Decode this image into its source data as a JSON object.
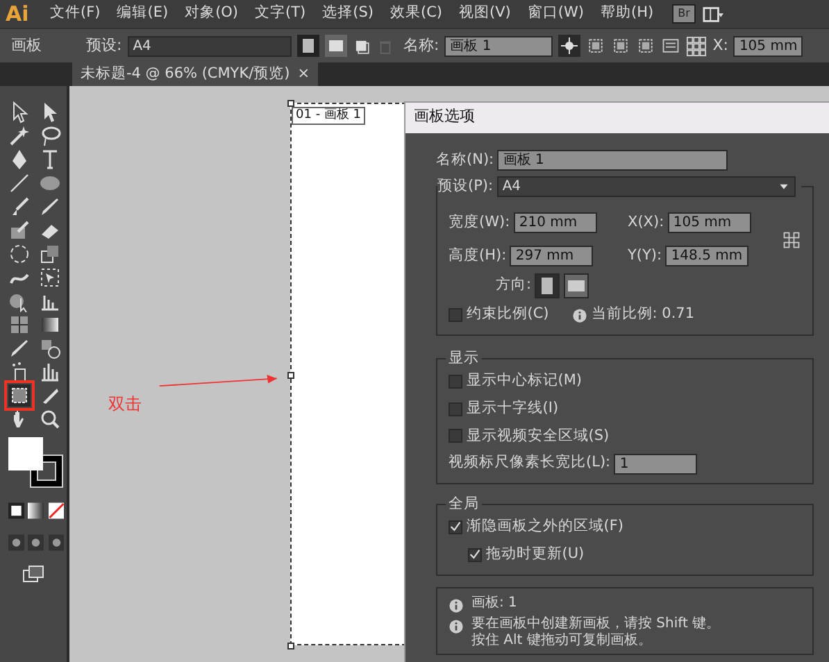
{
  "app_logo": "Ai",
  "menu": [
    "文件(F)",
    "编辑(E)",
    "对象(O)",
    "文字(T)",
    "选择(S)",
    "效果(C)",
    "视图(V)",
    "窗口(W)",
    "帮助(H)"
  ],
  "bridge_label": "Br",
  "control_bar": {
    "label": "画板",
    "preset_label": "预设:",
    "preset_value": "A4",
    "name_label": "名称:",
    "name_value": "画板 1",
    "x_label": "X:",
    "x_value": "105 mm"
  },
  "document_tab": {
    "title": "未标题-4 @ 66% (CMYK/预览)",
    "close": "×"
  },
  "artboard_label": "01 - 画板 1",
  "annotation": "双击",
  "dialog": {
    "title": "画板选项",
    "name_label": "名称(N):",
    "name_value": "画板 1",
    "preset_label": "预设(P):",
    "preset_value": "A4",
    "width_label": "宽度(W):",
    "width_value": "210 mm",
    "height_label": "高度(H):",
    "height_value": "297 mm",
    "x_label": "X(X):",
    "x_value": "105 mm",
    "y_label": "Y(Y):",
    "y_value": "148.5 mm",
    "orientation_label": "方向:",
    "orientation": [
      {
        "selected": true
      },
      {
        "selected": false
      }
    ],
    "constrain": {
      "label": "约束比例(C)",
      "checked": false
    },
    "current_ratio": "当前比例: 0.71",
    "display": {
      "title": "显示",
      "options": [
        {
          "label": "显示中心标记(M)",
          "checked": false
        },
        {
          "label": "显示十字线(I)",
          "checked": false
        },
        {
          "label": "显示视频安全区域(S)",
          "checked": false
        }
      ],
      "pixel_ratio_label": "视频标尺像素长宽比(L):",
      "pixel_ratio_value": "1"
    },
    "global": {
      "title": "全局",
      "options": [
        {
          "label": "渐隐画板之外的区域(F)",
          "checked": true,
          "children": [
            {
              "label": "拖动时更新(U)",
              "checked": true
            }
          ]
        }
      ]
    },
    "info": [
      {
        "lines": [
          "画板: 1"
        ]
      },
      {
        "lines": [
          "要在画板中创建新画板，请按 Shift 键。",
          "按住 Alt 键拖动可复制画板。"
        ]
      }
    ]
  }
}
